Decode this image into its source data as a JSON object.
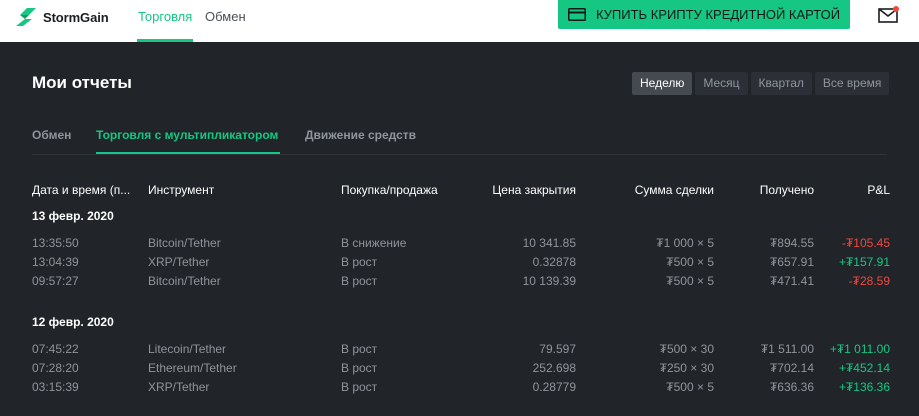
{
  "topbar": {
    "logo_text": "StormGain",
    "nav_trade": "Торговля",
    "nav_exchange": "Обмен",
    "buy_button_label": "КУПИТЬ КРИПТУ КРЕДИТНОЙ КАРТОЙ",
    "brand_color": "#16c784"
  },
  "page": {
    "title": "Мои отчеты",
    "periods": [
      "Неделю",
      "Месяц",
      "Квартал",
      "Все время"
    ],
    "selected_period": "Неделю",
    "tabs": [
      "Обмен",
      "Торговля с мультипликатором",
      "Движение средств"
    ],
    "selected_tab": "Торговля с мультипликатором"
  },
  "table": {
    "headers": [
      "Дата и время (п...",
      "Инструмент",
      "Покупка/продажа",
      "Цена закрытия",
      "Сумма сделки",
      "Получено",
      "P&L"
    ],
    "groups": [
      {
        "date": "13 февр. 2020",
        "rows": [
          [
            "13:35:50",
            "Bitcoin/Tether",
            "В снижение",
            "10 341.85",
            "₮1 000 × 5",
            "₮894.55",
            "-₮105.45"
          ],
          [
            "13:04:39",
            "XRP/Tether",
            "В рост",
            "0.32878",
            "₮500 × 5",
            "₮657.91",
            "+₮157.91"
          ],
          [
            "09:57:27",
            "Bitcoin/Tether",
            "В рост",
            "10 139.39",
            "₮500 × 5",
            "₮471.41",
            "-₮28.59"
          ]
        ]
      },
      {
        "date": "12 февр. 2020",
        "rows": [
          [
            "07:45:22",
            "Litecoin/Tether",
            "В рост",
            "79.597",
            "₮500 × 30",
            "₮1 511.00",
            "+₮1 011.00"
          ],
          [
            "07:28:20",
            "Ethereum/Tether",
            "В рост",
            "252.698",
            "₮250 × 30",
            "₮702.14",
            "+₮452.14"
          ],
          [
            "03:15:39",
            "XRP/Tether",
            "В рост",
            "0.28779",
            "₮500 × 5",
            "₮636.36",
            "+₮136.36"
          ]
        ]
      }
    ]
  }
}
